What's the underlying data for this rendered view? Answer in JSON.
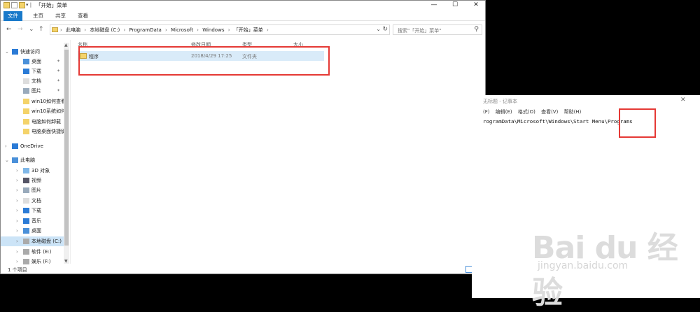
{
  "explorer": {
    "title": "「开始」菜单",
    "window_controls": {
      "minimize": "—",
      "maximize": "☐",
      "close": "✕"
    },
    "ribbon_tabs": [
      "文件",
      "主页",
      "共享",
      "查看"
    ],
    "breadcrumb": [
      "此电脑",
      "本地磁盘 (C:)",
      "ProgramData",
      "Microsoft",
      "Windows",
      "「开始」菜单"
    ],
    "search_placeholder": "搜索\"「开始」菜单\"",
    "columns": {
      "name": "名称",
      "modified": "修改日期",
      "type": "类型",
      "size": "大小"
    },
    "files": [
      {
        "name": "程序",
        "modified": "2018/4/29 17:25",
        "type": "文件夹",
        "size": ""
      }
    ],
    "status": "1 个项目",
    "nav": [
      {
        "label": "快速访问",
        "icon": "star-icon",
        "indent": 0,
        "expandable": true
      },
      {
        "label": "桌面",
        "icon": "desktop-icon",
        "indent": 1,
        "pinned": true
      },
      {
        "label": "下载",
        "icon": "download-icon",
        "indent": 1,
        "pinned": true
      },
      {
        "label": "文档",
        "icon": "document-icon",
        "indent": 1,
        "pinned": true
      },
      {
        "label": "图片",
        "icon": "picture-icon",
        "indent": 1,
        "pinned": true
      },
      {
        "label": "win10如何查看",
        "icon": "folder-icon",
        "indent": 1
      },
      {
        "label": "win10系统如何",
        "icon": "folder-icon",
        "indent": 1
      },
      {
        "label": "电脑如何卸载",
        "icon": "folder-icon",
        "indent": 1
      },
      {
        "label": "电脑桌面快捷键",
        "icon": "folder-icon",
        "indent": 1
      },
      {
        "label": "OneDrive",
        "icon": "cloud-icon",
        "indent": 0,
        "expandable": true
      },
      {
        "label": "此电脑",
        "icon": "computer-icon",
        "indent": 0,
        "expandable": true
      },
      {
        "label": "3D 对象",
        "icon": "cube-icon",
        "indent": 1,
        "expandable": true
      },
      {
        "label": "视频",
        "icon": "video-icon",
        "indent": 1,
        "expandable": true
      },
      {
        "label": "图片",
        "icon": "picture-icon",
        "indent": 1,
        "expandable": true
      },
      {
        "label": "文档",
        "icon": "document-icon",
        "indent": 1,
        "expandable": true
      },
      {
        "label": "下载",
        "icon": "download-icon",
        "indent": 1,
        "expandable": true
      },
      {
        "label": "音乐",
        "icon": "music-icon",
        "indent": 1,
        "expandable": true
      },
      {
        "label": "桌面",
        "icon": "desktop-icon",
        "indent": 1,
        "expandable": true
      },
      {
        "label": "本地磁盘 (C:)",
        "icon": "drive-icon",
        "indent": 1,
        "expandable": true,
        "selected": true
      },
      {
        "label": "软件 (E:)",
        "icon": "drive-icon",
        "indent": 1,
        "expandable": true
      },
      {
        "label": "娱乐 (F:)",
        "icon": "drive-icon",
        "indent": 1,
        "expandable": true
      }
    ]
  },
  "notepad": {
    "title": "无标题 - 记事本",
    "close": "✕",
    "menu": [
      "(F)",
      "编辑(E)",
      "格式(O)",
      "查看(V)",
      "帮助(H)"
    ],
    "text": "rogramData\\Microsoft\\Windows\\Start Menu\\Programs"
  },
  "watermark": {
    "logo": "Bai du 经验",
    "url": "jingyan.baidu.com"
  },
  "colors": {
    "accent": "#1979ca",
    "highlight": "#e53935",
    "selection": "#cce4f7"
  }
}
